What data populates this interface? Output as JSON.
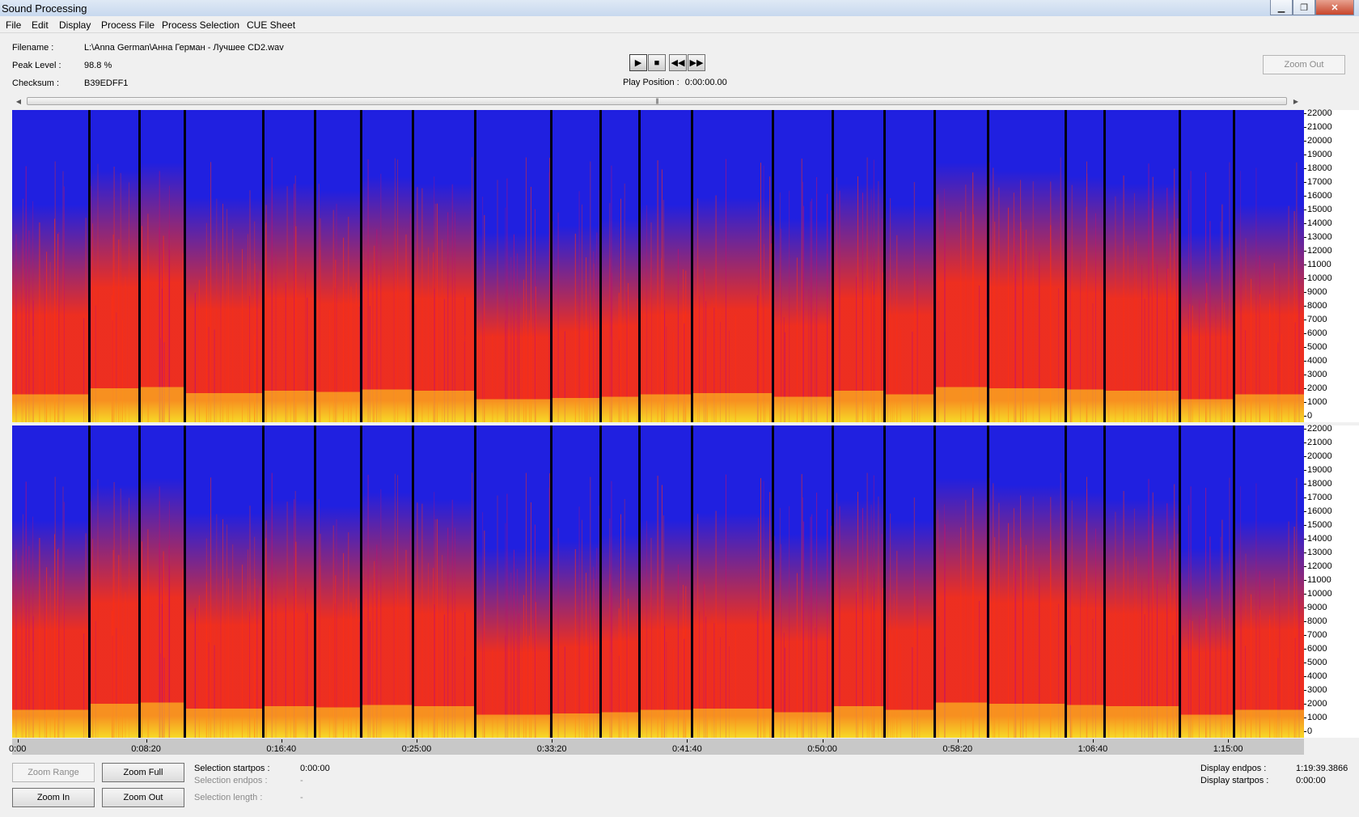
{
  "window": {
    "title": "Sound Processing"
  },
  "menu": [
    "File",
    "Edit",
    "Display",
    "Process File",
    "Process Selection",
    "CUE Sheet"
  ],
  "info": {
    "filename_label": "Filename :",
    "filename_value": "L:\\Anna German\\Анна Герман - Лучшее CD2.wav",
    "peak_label": "Peak Level :",
    "peak_value": "98.8 %",
    "checksum_label": "Checksum :",
    "checksum_value": "B39EDFF1"
  },
  "transport": {
    "play_position_label": "Play Position :",
    "play_position_value": "0:00:00.00"
  },
  "zoom_out_top": "Zoom Out",
  "freq_axis": {
    "labels": [
      "22000",
      "21000",
      "20000",
      "19000",
      "18000",
      "17000",
      "16000",
      "15000",
      "14000",
      "13000",
      "12000",
      "11000",
      "10000",
      "9000",
      "8000",
      "7000",
      "6000",
      "5000",
      "4000",
      "3000",
      "2000",
      "1000",
      "0"
    ]
  },
  "time_axis": {
    "labels": [
      "0:00",
      "0:08:20",
      "0:16:40",
      "0:25:00",
      "0:33:20",
      "0:41:40",
      "0:50:00",
      "0:58:20",
      "1:06:40",
      "1:15:00"
    ]
  },
  "buttons": {
    "zoom_range": "Zoom Range",
    "zoom_full": "Zoom Full",
    "zoom_in": "Zoom In",
    "zoom_out": "Zoom Out"
  },
  "selection": {
    "startpos_label": "Selection startpos :",
    "startpos_value": "0:00:00",
    "endpos_label": "Selection endpos :",
    "endpos_value": "-",
    "length_label": "Selection length :",
    "length_value": "-"
  },
  "display": {
    "endpos_label": "Display endpos :",
    "endpos_value": "1:19:39.3866",
    "startpos_label": "Display startpos :",
    "startpos_value": "0:00:00"
  },
  "spectrogram": {
    "track_count": 23,
    "colors": {
      "background": "#2020e0",
      "low": "#ff3010",
      "high": "#ffe020",
      "silence": "#000010"
    }
  }
}
